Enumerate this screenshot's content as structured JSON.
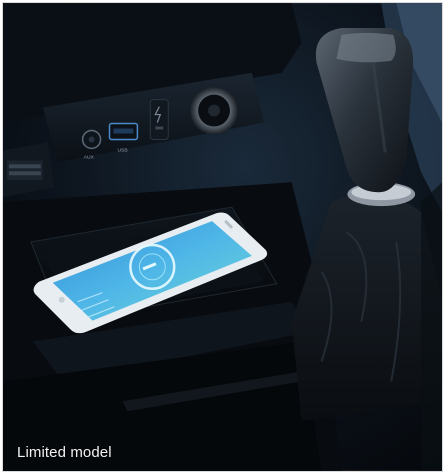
{
  "caption": "Limited model",
  "photo": {
    "panel_labels": {
      "aux": "AUX",
      "usb": "USB"
    },
    "icons": [
      "aux-port-icon",
      "usb-port-icon",
      "charging-pad-icon",
      "power-outlet-icon",
      "gear-shift-knob-icon",
      "phone-charging-icon"
    ]
  },
  "colors": {
    "interior_dark": "#0a0e14",
    "console_blue": "#1a2a3d",
    "screen_blue": "#3a9ad6",
    "screen_cyan": "#5fe0f0",
    "phone_white": "#eef2f5",
    "chrome": "#9aa3ad"
  }
}
